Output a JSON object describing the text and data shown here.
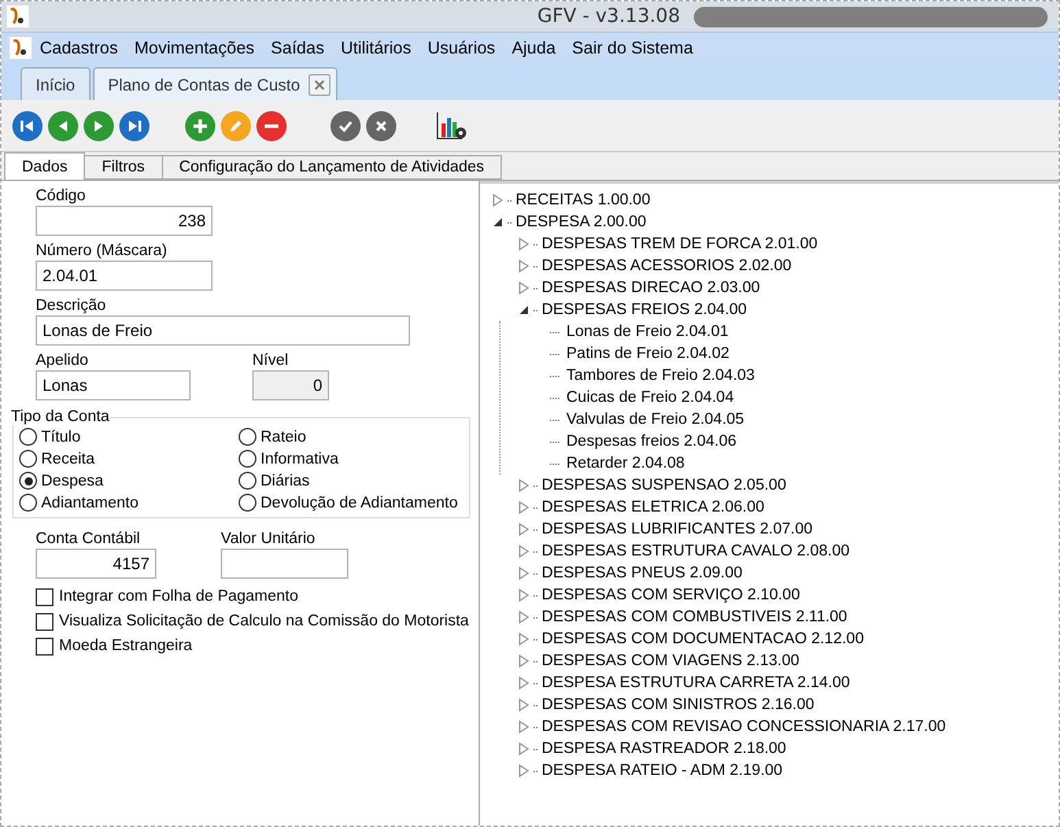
{
  "window": {
    "title": "GFV - v3.13.08"
  },
  "menu": [
    "Cadastros",
    "Movimentações",
    "Saídas",
    "Utilitários",
    "Usuários",
    "Ajuda",
    "Sair do Sistema"
  ],
  "doc_tabs": [
    {
      "label": "Início",
      "selected": false,
      "closable": false
    },
    {
      "label": "Plano de Contas de Custo",
      "selected": true,
      "closable": true
    }
  ],
  "form_tabs": [
    {
      "label": "Dados",
      "selected": true
    },
    {
      "label": "Filtros",
      "selected": false
    },
    {
      "label": "Configuração do Lançamento de Atividades",
      "selected": false
    }
  ],
  "fields": {
    "codigo": {
      "label": "Código",
      "value": "238"
    },
    "numero": {
      "label": "Número (Máscara)",
      "value": "2.04.01"
    },
    "descricao": {
      "label": "Descrição",
      "value": "Lonas de Freio"
    },
    "apelido": {
      "label": "Apelido",
      "value": "Lonas"
    },
    "nivel": {
      "label": "Nível",
      "value": "0",
      "disabled": true
    },
    "conta_contabil": {
      "label": "Conta Contábil",
      "value": "4157"
    },
    "valor_unitario": {
      "label": "Valor Unitário"
    }
  },
  "tipo_da_conta": {
    "title": "Tipo da Conta",
    "options": [
      {
        "label": "Título",
        "selected": false
      },
      {
        "label": "Rateio",
        "selected": false
      },
      {
        "label": "Receita",
        "selected": false
      },
      {
        "label": "Informativa",
        "selected": false
      },
      {
        "label": "Despesa",
        "selected": true
      },
      {
        "label": "Diárias",
        "selected": false
      },
      {
        "label": "Adiantamento",
        "selected": false
      },
      {
        "label": "Devolução de Adiantamento",
        "selected": false
      }
    ]
  },
  "checkboxes": [
    {
      "label": "Integrar com Folha de Pagamento",
      "checked": false
    },
    {
      "label": "Visualiza Solicitação de Calculo na Comissão do Motorista",
      "checked": false
    },
    {
      "label": "Moeda Estrangeira",
      "checked": false
    }
  ],
  "tree": [
    {
      "label": "RECEITAS 1.00.00",
      "kind": "branch",
      "expanded": false
    },
    {
      "label": "DESPESA 2.00.00",
      "kind": "branch",
      "expanded": true,
      "children": [
        {
          "label": "DESPESAS TREM DE FORCA 2.01.00",
          "kind": "branch",
          "expanded": false
        },
        {
          "label": "DESPESAS ACESSORIOS 2.02.00",
          "kind": "branch",
          "expanded": false
        },
        {
          "label": "DESPESAS DIRECAO 2.03.00",
          "kind": "branch",
          "expanded": false
        },
        {
          "label": "DESPESAS FREIOS 2.04.00",
          "kind": "branch",
          "expanded": true,
          "children": [
            {
              "label": "Lonas de Freio 2.04.01",
              "kind": "leaf"
            },
            {
              "label": "Patins de Freio 2.04.02",
              "kind": "leaf"
            },
            {
              "label": "Tambores de Freio 2.04.03",
              "kind": "leaf"
            },
            {
              "label": "Cuicas de Freio 2.04.04",
              "kind": "leaf"
            },
            {
              "label": "Valvulas de Freio 2.04.05",
              "kind": "leaf"
            },
            {
              "label": "Despesas freios 2.04.06",
              "kind": "leaf"
            },
            {
              "label": "Retarder 2.04.08",
              "kind": "leaf"
            }
          ]
        },
        {
          "label": "DESPESAS SUSPENSAO 2.05.00",
          "kind": "branch",
          "expanded": false
        },
        {
          "label": "DESPESAS ELETRICA 2.06.00",
          "kind": "branch",
          "expanded": false
        },
        {
          "label": "DESPESAS LUBRIFICANTES 2.07.00",
          "kind": "branch",
          "expanded": false
        },
        {
          "label": "DESPESAS ESTRUTURA CAVALO 2.08.00",
          "kind": "branch",
          "expanded": false
        },
        {
          "label": "DESPESAS PNEUS 2.09.00",
          "kind": "branch",
          "expanded": false
        },
        {
          "label": "DESPESAS COM SERVIÇO 2.10.00",
          "kind": "branch",
          "expanded": false
        },
        {
          "label": "DESPESAS COM COMBUSTIVEIS 2.11.00",
          "kind": "branch",
          "expanded": false
        },
        {
          "label": "DESPESAS COM DOCUMENTACAO 2.12.00",
          "kind": "branch",
          "expanded": false
        },
        {
          "label": "DESPESAS COM VIAGENS 2.13.00",
          "kind": "branch",
          "expanded": false
        },
        {
          "label": "DESPESA ESTRUTURA CARRETA 2.14.00",
          "kind": "branch",
          "expanded": false
        },
        {
          "label": "DESPESAS COM SINISTROS 2.16.00",
          "kind": "branch",
          "expanded": false
        },
        {
          "label": "DESPESAS COM REVISAO CONCESSIONARIA 2.17.00",
          "kind": "branch",
          "expanded": false
        },
        {
          "label": "DESPESA RASTREADOR 2.18.00",
          "kind": "branch",
          "expanded": false
        },
        {
          "label": "DESPESA RATEIO - ADM 2.19.00",
          "kind": "branch",
          "expanded": false
        }
      ]
    }
  ]
}
